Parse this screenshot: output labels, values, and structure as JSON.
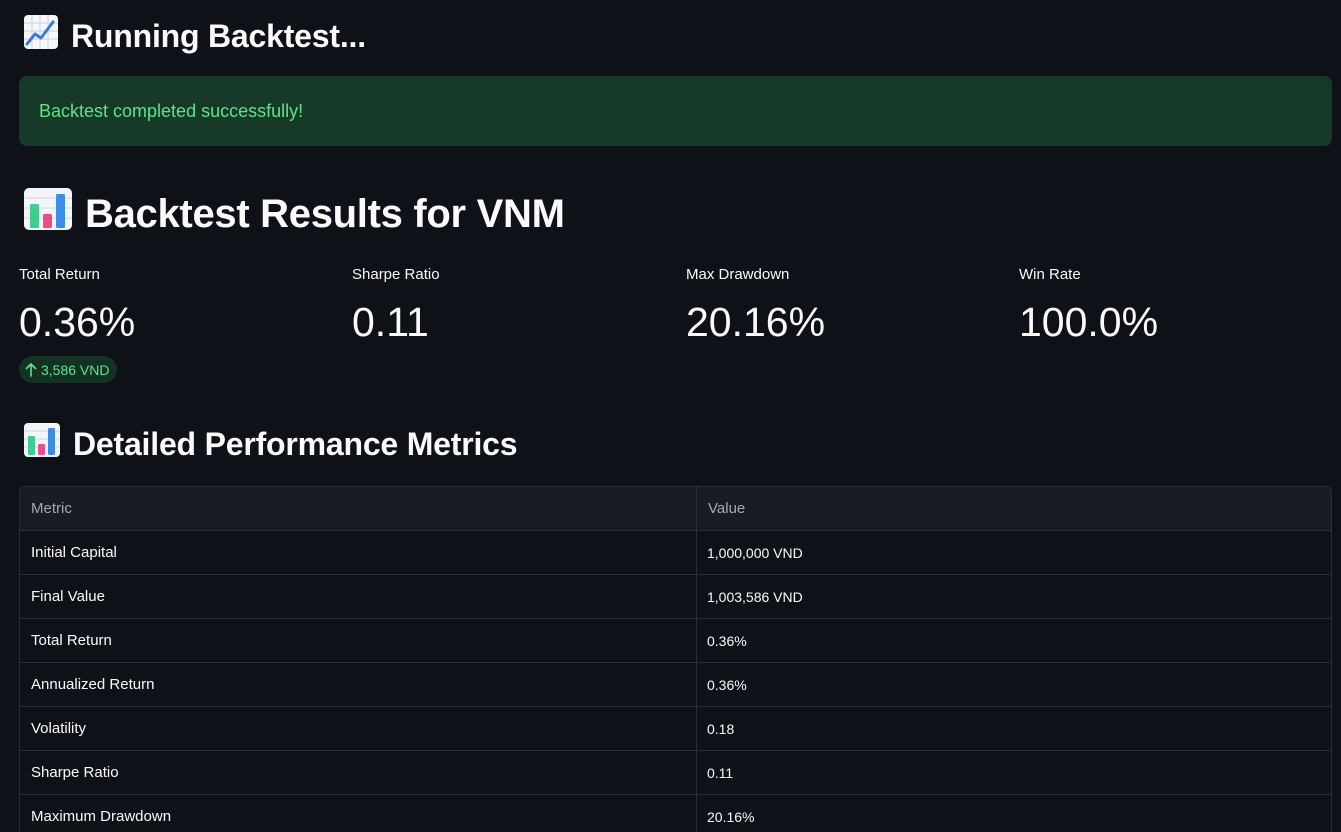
{
  "running_section": {
    "title": "Running Backtest...",
    "icon": "chart-increasing-icon"
  },
  "alert": {
    "message": "Backtest completed successfully!",
    "color": "#5ce488",
    "background": "#173928"
  },
  "results_section": {
    "title": "Backtest Results for VNM",
    "icon": "bar-chart-icon"
  },
  "metrics": [
    {
      "label": "Total Return",
      "value": "0.36%",
      "delta": "3,586 VND",
      "delta_direction": "up"
    },
    {
      "label": "Sharpe Ratio",
      "value": "0.11"
    },
    {
      "label": "Max Drawdown",
      "value": "20.16%"
    },
    {
      "label": "Win Rate",
      "value": "100.0%"
    }
  ],
  "detailed_section": {
    "title": "Detailed Performance Metrics",
    "icon": "bar-chart-icon"
  },
  "table": {
    "headers": [
      "Metric",
      "Value"
    ],
    "rows": [
      [
        "Initial Capital",
        "1,000,000 VND"
      ],
      [
        "Final Value",
        "1,003,586 VND"
      ],
      [
        "Total Return",
        "0.36%"
      ],
      [
        "Annualized Return",
        "0.36%"
      ],
      [
        "Volatility",
        "0.18"
      ],
      [
        "Sharpe Ratio",
        "0.11"
      ],
      [
        "Maximum Drawdown",
        "20.16%"
      ]
    ]
  },
  "colors": {
    "background": "#0e1117",
    "text": "#fafafa",
    "positive": "#5ce488"
  }
}
